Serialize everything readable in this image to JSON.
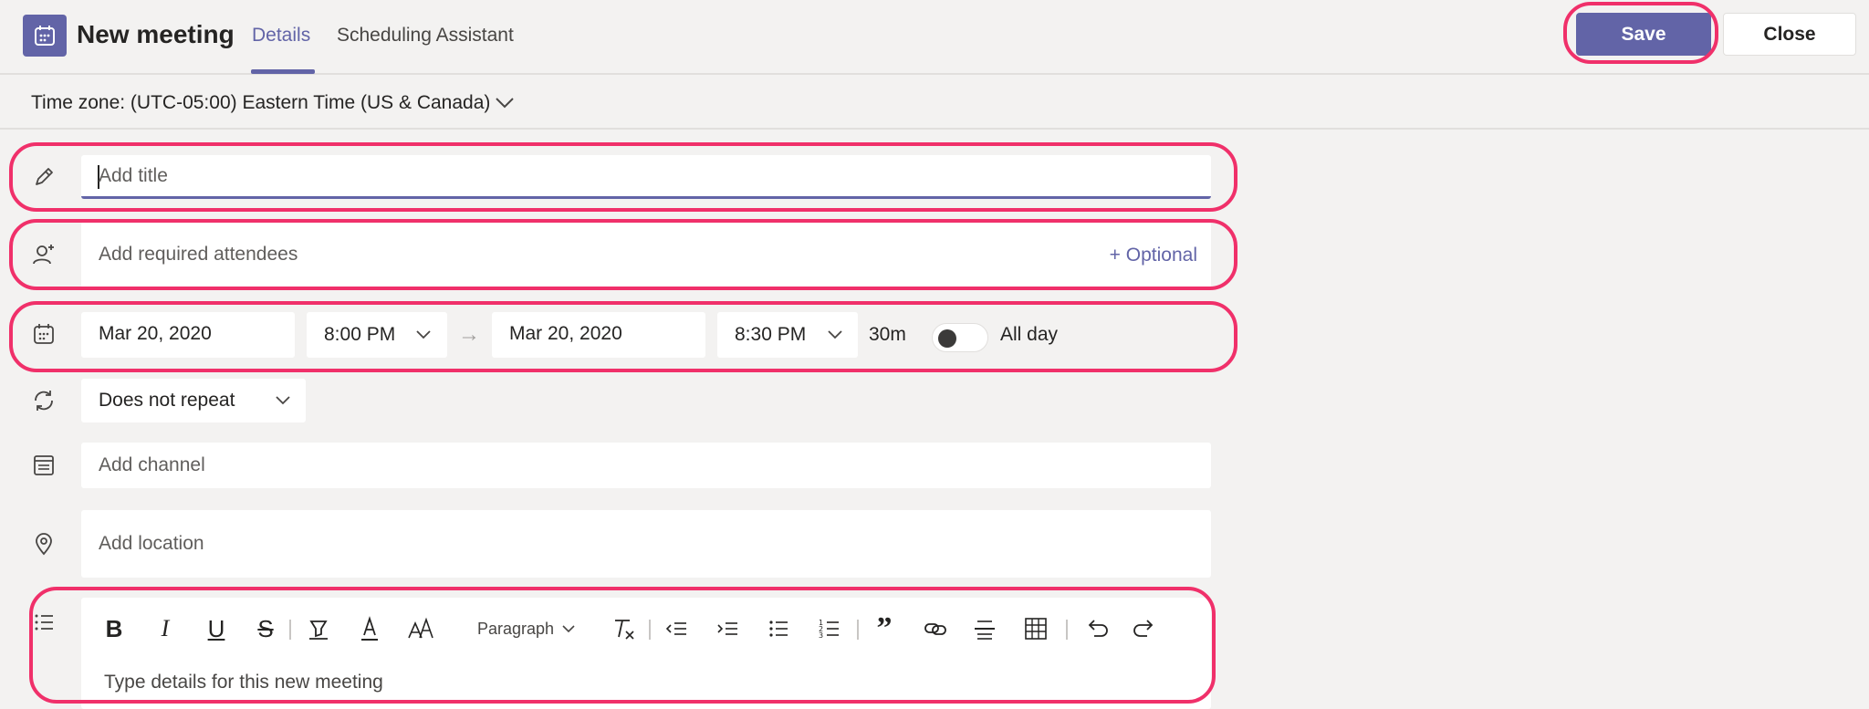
{
  "header": {
    "title": "New meeting",
    "tabs": [
      {
        "label": "Details",
        "active": true
      },
      {
        "label": "Scheduling Assistant",
        "active": false
      }
    ],
    "save_label": "Save",
    "close_label": "Close"
  },
  "timezone": {
    "label": "Time zone: (UTC-05:00) Eastern Time (US & Canada)"
  },
  "form": {
    "title_placeholder": "Add title",
    "attendees_placeholder": "Add required attendees",
    "optional_label": "+ Optional",
    "start_date": "Mar 20, 2020",
    "start_time": "8:00 PM",
    "end_date": "Mar 20, 2020",
    "end_time": "8:30 PM",
    "duration": "30m",
    "allday_label": "All day",
    "allday_on": false,
    "repeat": "Does not repeat",
    "channel_placeholder": "Add channel",
    "location_placeholder": "Add location",
    "details_placeholder": "Type details for this new meeting"
  },
  "toolbar": {
    "paragraph_label": "Paragraph"
  },
  "colors": {
    "accent": "#6264a7",
    "highlight": "#f0306a",
    "background": "#f3f2f1"
  }
}
